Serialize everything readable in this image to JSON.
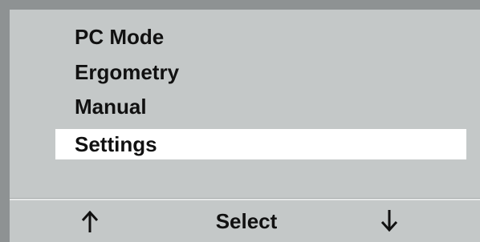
{
  "menu": {
    "items": [
      {
        "label": "PC Mode",
        "selected": false
      },
      {
        "label": "Ergometry",
        "selected": false
      },
      {
        "label": "Manual",
        "selected": false
      },
      {
        "label": "Settings",
        "selected": true
      }
    ]
  },
  "softkeys": {
    "up_icon": "arrow-up-icon",
    "select_label": "Select",
    "down_icon": "arrow-down-icon"
  },
  "colors": {
    "screen_background": "#c4c8c8",
    "bezel": "#8e9293",
    "highlight": "#ffffff",
    "text": "#111111"
  }
}
